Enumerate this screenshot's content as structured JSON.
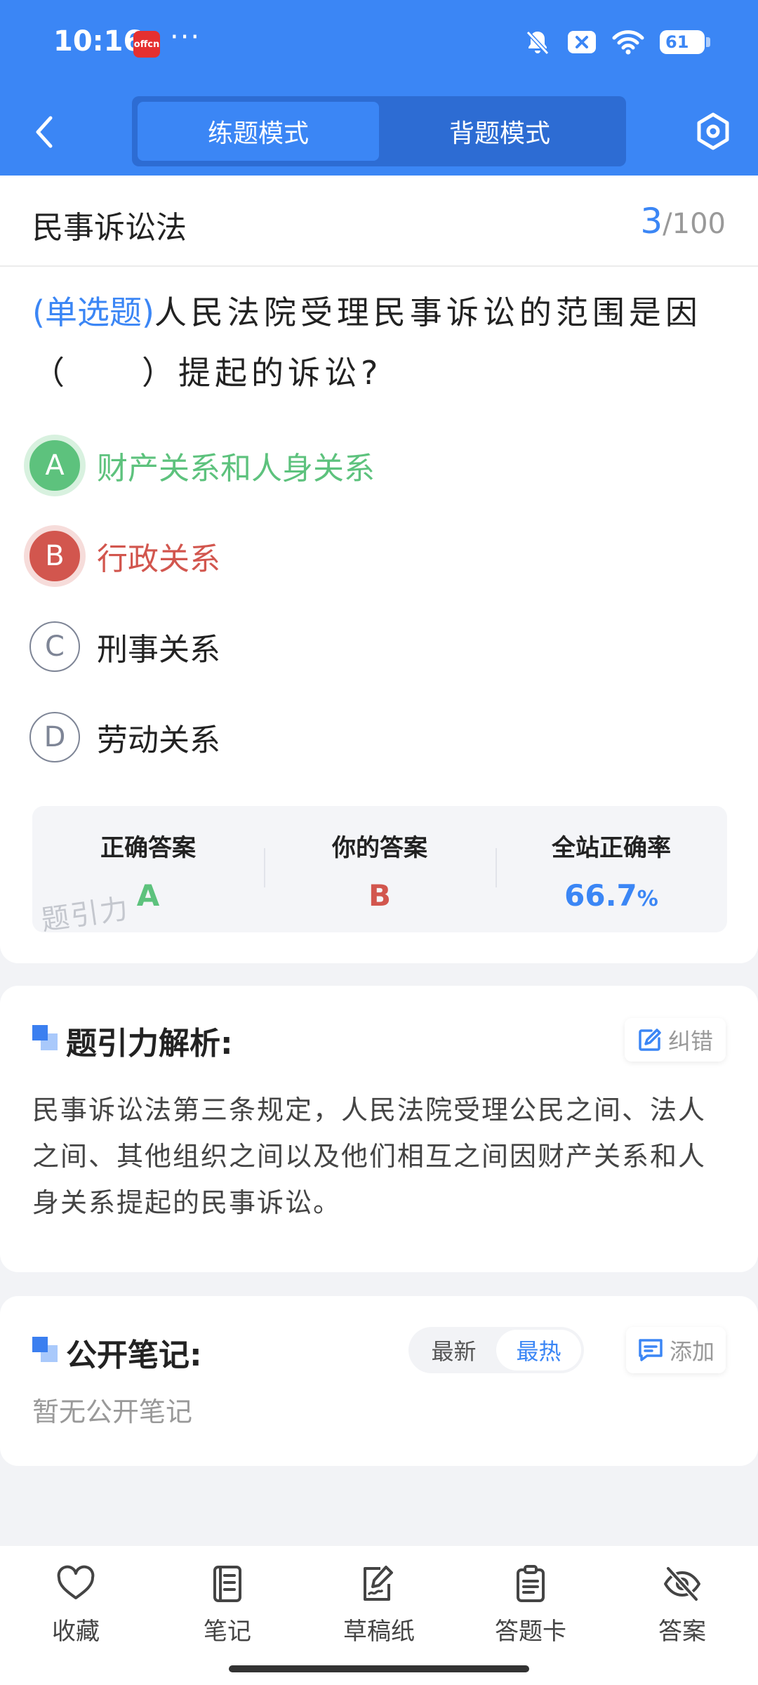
{
  "status": {
    "time": "10:16",
    "app_badge": "offcn",
    "more": "···",
    "battery": "61"
  },
  "nav": {
    "tabs": [
      {
        "label": "练题模式",
        "active": true
      },
      {
        "label": "背题模式",
        "active": false
      }
    ]
  },
  "subject": {
    "title": "民事诉讼法",
    "current": "3",
    "total": "/100"
  },
  "question": {
    "type": "(单选题)",
    "stem": "人民法院受理民事诉讼的范围是因（　　）提起的诉讼?"
  },
  "options": [
    {
      "letter": "A",
      "text": "财产关系和人身关系",
      "state": "correct"
    },
    {
      "letter": "B",
      "text": "行政关系",
      "state": "wrong"
    },
    {
      "letter": "C",
      "text": "刑事关系",
      "state": "normal"
    },
    {
      "letter": "D",
      "text": "劳动关系",
      "state": "normal"
    }
  ],
  "summary": {
    "correct_label": "正确答案",
    "correct_value": "A",
    "yours_label": "你的答案",
    "yours_value": "B",
    "rate_label": "全站正确率",
    "rate_value": "66.7",
    "rate_unit": "%",
    "watermark": "题引力"
  },
  "analysis": {
    "title": "题引力解析:",
    "report_label": "纠错",
    "text": "民事诉讼法第三条规定，人民法院受理公民之间、法人之间、其他组织之间以及他们相互之间因财产关系和人身关系提起的民事诉讼。"
  },
  "notes": {
    "title": "公开笔记:",
    "sort_options": [
      "最新",
      "最热"
    ],
    "sort_active": "最热",
    "add_label": "添加",
    "empty_text": "暂无公开笔记"
  },
  "toolbar": {
    "items": [
      {
        "label": "收藏",
        "icon": "heart-icon"
      },
      {
        "label": "笔记",
        "icon": "notebook-icon"
      },
      {
        "label": "草稿纸",
        "icon": "draft-icon"
      },
      {
        "label": "答题卡",
        "icon": "answer-card-icon"
      },
      {
        "label": "答案",
        "icon": "eye-off-icon"
      }
    ]
  },
  "colors": {
    "primary": "#3b86f5",
    "correct": "#5dc27d",
    "wrong": "#d2564e"
  }
}
